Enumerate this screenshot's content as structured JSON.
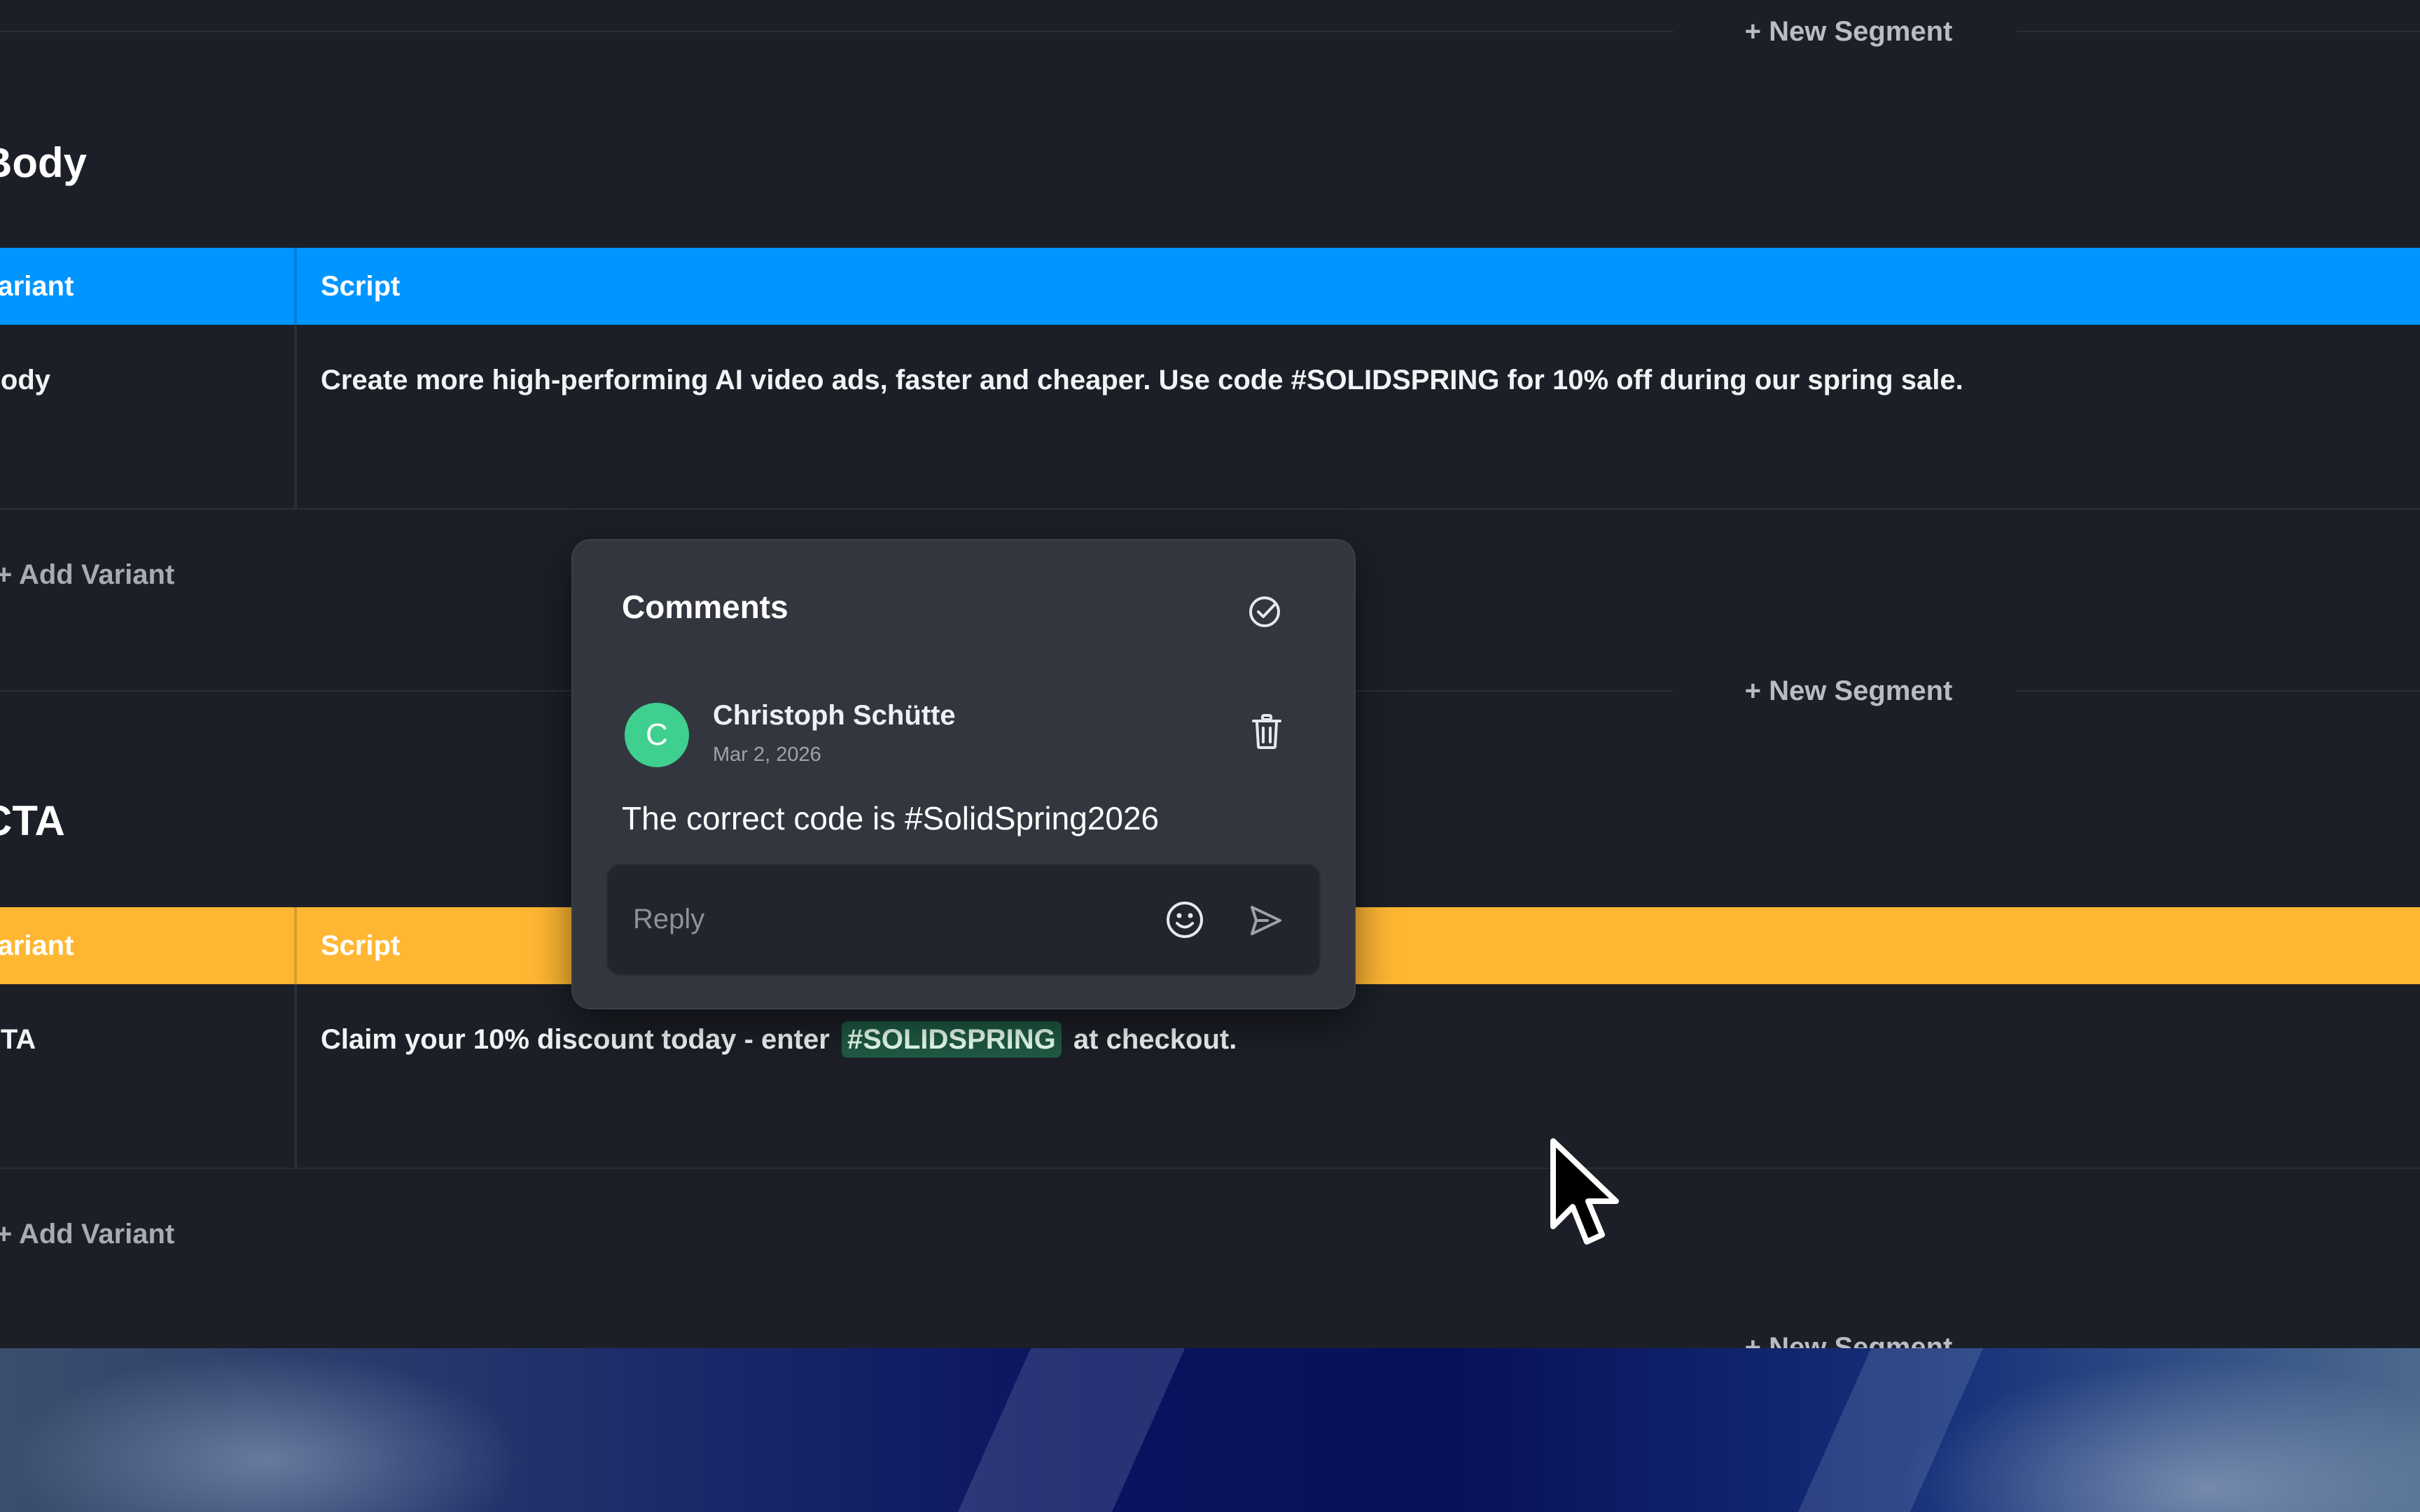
{
  "segments": {
    "new_segment_label": "+ New Segment",
    "add_variant_label": "+ Add Variant",
    "body": {
      "title": "Body",
      "header_variant": "Variant",
      "header_script": "Script",
      "header_color": "#0095ff",
      "row_variant": "Body",
      "row_script": "Create more high-performing AI video ads, faster and cheaper. Use code #SOLIDSPRING for 10% off during our spring sale."
    },
    "cta": {
      "title": "CTA",
      "header_variant": "Variant",
      "header_script": "Script",
      "header_color": "#ffb733",
      "row_variant": "CTA",
      "row_script_before": "Claim your 10% discount today - enter",
      "row_script_highlight": "#SOLIDSPRING",
      "row_script_after": "at checkout."
    }
  },
  "comments": {
    "title": "Comments",
    "resolve_icon": "check-circle-icon",
    "author_initial": "C",
    "author_name": "Christoph Schütte",
    "date": "Mar 2, 2026",
    "body": "The correct code is #SolidSpring2026",
    "delete_icon": "trash-icon",
    "reply_placeholder": "Reply",
    "emoji_icon": "smiley-icon",
    "send_icon": "send-icon",
    "avatar_color": "#3fcf8e"
  },
  "colors": {
    "app_bg": "#1c1f27",
    "popover_bg": "#33363f",
    "highlight_bg": "#1f5a44"
  }
}
